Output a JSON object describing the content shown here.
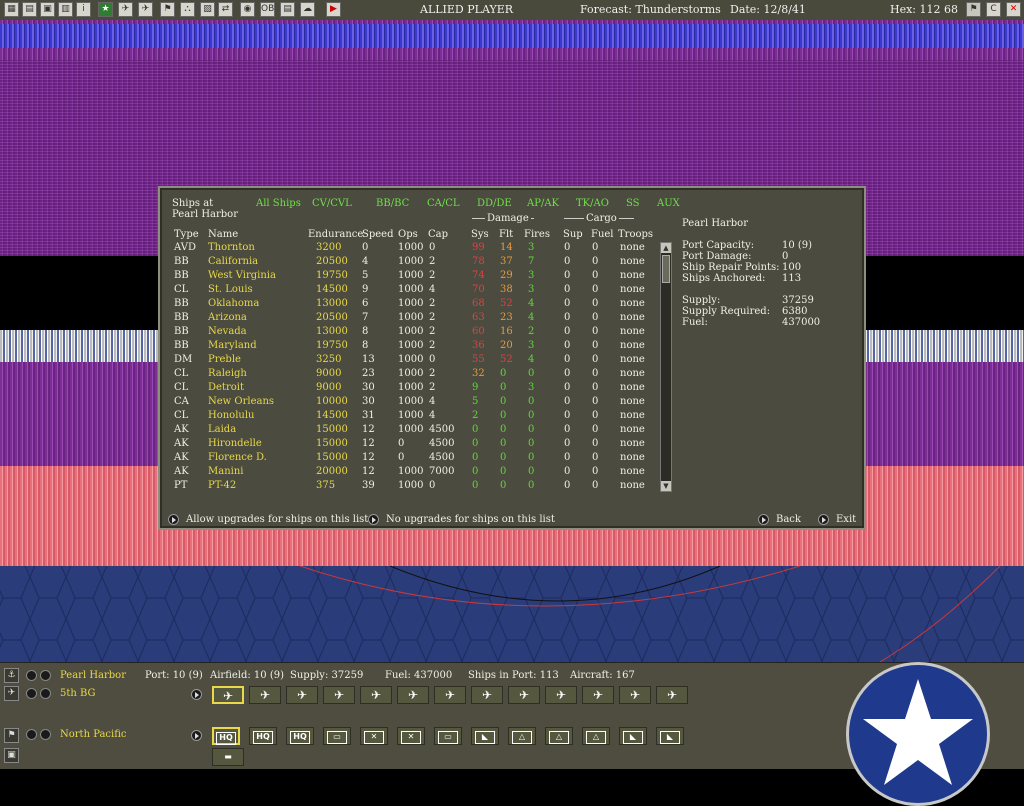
{
  "topbar": {
    "player": "ALLIED PLAYER",
    "forecast": "Forecast: Thunderstorms",
    "date": "Date: 12/8/41",
    "hex": "Hex: 112 68",
    "icons": [
      "menu-icon",
      "list-icon",
      "ship-list-icon",
      "report-icon",
      "info-icon",
      "star-icon",
      "air-icon",
      "aircraft-icon",
      "flag-icon",
      "ground-icon",
      "map-icon",
      "filter-icon",
      "globe-icon",
      "ob-icon",
      "doc-icon",
      "cloud-icon",
      "end-turn-icon"
    ],
    "right_icons": [
      "flag-icon",
      "c-icon",
      "close-icon"
    ]
  },
  "dialog": {
    "title_line1": "Ships at",
    "title_line2": "Pearl Harbor",
    "tabs": [
      "All Ships",
      "CV/CVL",
      "BB/BC",
      "CA/CL",
      "DD/DE",
      "AP/AK",
      "TK/AO",
      "SS",
      "AUX"
    ],
    "group_damage": "Damage",
    "group_cargo": "Cargo",
    "columns": [
      "Type",
      "Name",
      "Endurance",
      "Speed",
      "Ops",
      "Cap",
      "Sys",
      "Flt",
      "Fires",
      "Sup",
      "Fuel",
      "Troops"
    ],
    "rows": [
      {
        "type": "AVD",
        "name": "Thornton",
        "endurance": "3200",
        "speed": "0",
        "ops": "1000",
        "cap": "0",
        "sys": "99",
        "flt": "14",
        "fires": "3",
        "sup": "0",
        "fuel": "0",
        "troops": "none"
      },
      {
        "type": "BB",
        "name": "California",
        "endurance": "20500",
        "speed": "4",
        "ops": "1000",
        "cap": "2",
        "sys": "78",
        "flt": "37",
        "fires": "7",
        "sup": "0",
        "fuel": "0",
        "troops": "none"
      },
      {
        "type": "BB",
        "name": "West Virginia",
        "endurance": "19750",
        "speed": "5",
        "ops": "1000",
        "cap": "2",
        "sys": "74",
        "flt": "29",
        "fires": "3",
        "sup": "0",
        "fuel": "0",
        "troops": "none"
      },
      {
        "type": "CL",
        "name": "St. Louis",
        "endurance": "14500",
        "speed": "9",
        "ops": "1000",
        "cap": "4",
        "sys": "70",
        "flt": "38",
        "fires": "3",
        "sup": "0",
        "fuel": "0",
        "troops": "none"
      },
      {
        "type": "BB",
        "name": "Oklahoma",
        "endurance": "13000",
        "speed": "6",
        "ops": "1000",
        "cap": "2",
        "sys": "68",
        "flt": "52",
        "fires": "4",
        "sup": "0",
        "fuel": "0",
        "troops": "none"
      },
      {
        "type": "BB",
        "name": "Arizona",
        "endurance": "20500",
        "speed": "7",
        "ops": "1000",
        "cap": "2",
        "sys": "63",
        "flt": "23",
        "fires": "4",
        "sup": "0",
        "fuel": "0",
        "troops": "none"
      },
      {
        "type": "BB",
        "name": "Nevada",
        "endurance": "13000",
        "speed": "8",
        "ops": "1000",
        "cap": "2",
        "sys": "60",
        "flt": "16",
        "fires": "2",
        "sup": "0",
        "fuel": "0",
        "troops": "none"
      },
      {
        "type": "BB",
        "name": "Maryland",
        "endurance": "19750",
        "speed": "8",
        "ops": "1000",
        "cap": "2",
        "sys": "36",
        "flt": "20",
        "fires": "3",
        "sup": "0",
        "fuel": "0",
        "troops": "none"
      },
      {
        "type": "DM",
        "name": "Preble",
        "endurance": "3250",
        "speed": "13",
        "ops": "1000",
        "cap": "0",
        "sys": "55",
        "flt": "52",
        "fires": "4",
        "sup": "0",
        "fuel": "0",
        "troops": "none"
      },
      {
        "type": "CL",
        "name": "Raleigh",
        "endurance": "9000",
        "speed": "23",
        "ops": "1000",
        "cap": "2",
        "sys": "32",
        "flt": "0",
        "fires": "0",
        "sup": "0",
        "fuel": "0",
        "troops": "none"
      },
      {
        "type": "CL",
        "name": "Detroit",
        "endurance": "9000",
        "speed": "30",
        "ops": "1000",
        "cap": "2",
        "sys": "9",
        "flt": "0",
        "fires": "3",
        "sup": "0",
        "fuel": "0",
        "troops": "none"
      },
      {
        "type": "CA",
        "name": "New Orleans",
        "endurance": "10000",
        "speed": "30",
        "ops": "1000",
        "cap": "4",
        "sys": "5",
        "flt": "0",
        "fires": "0",
        "sup": "0",
        "fuel": "0",
        "troops": "none"
      },
      {
        "type": "CL",
        "name": "Honolulu",
        "endurance": "14500",
        "speed": "31",
        "ops": "1000",
        "cap": "4",
        "sys": "2",
        "flt": "0",
        "fires": "0",
        "sup": "0",
        "fuel": "0",
        "troops": "none"
      },
      {
        "type": "AK",
        "name": "Laida",
        "endurance": "15000",
        "speed": "12",
        "ops": "1000",
        "cap": "4500",
        "sys": "0",
        "flt": "0",
        "fires": "0",
        "sup": "0",
        "fuel": "0",
        "troops": "none"
      },
      {
        "type": "AK",
        "name": "Hirondelle",
        "endurance": "15000",
        "speed": "12",
        "ops": "0",
        "cap": "4500",
        "sys": "0",
        "flt": "0",
        "fires": "0",
        "sup": "0",
        "fuel": "0",
        "troops": "none"
      },
      {
        "type": "AK",
        "name": "Florence D.",
        "endurance": "15000",
        "speed": "12",
        "ops": "0",
        "cap": "4500",
        "sys": "0",
        "flt": "0",
        "fires": "0",
        "sup": "0",
        "fuel": "0",
        "troops": "none"
      },
      {
        "type": "AK",
        "name": "Manini",
        "endurance": "20000",
        "speed": "12",
        "ops": "1000",
        "cap": "7000",
        "sys": "0",
        "flt": "0",
        "fires": "0",
        "sup": "0",
        "fuel": "0",
        "troops": "none"
      },
      {
        "type": "PT",
        "name": "PT-42",
        "endurance": "375",
        "speed": "39",
        "ops": "1000",
        "cap": "0",
        "sys": "0",
        "flt": "0",
        "fires": "0",
        "sup": "0",
        "fuel": "0",
        "troops": "none"
      }
    ],
    "sys_colors": [
      "#e04040",
      "#e04040",
      "#e04040",
      "#e04040",
      "#e04040",
      "#e04040",
      "#e04040",
      "#e04040",
      "#e04040",
      "#e89a3c",
      "#5fd83c",
      "#5fd83c",
      "#5fd83c",
      "#5fd83c",
      "#5fd83c",
      "#5fd83c",
      "#5fd83c",
      "#5fd83c"
    ],
    "flt_colors": [
      "#e89a3c",
      "#e89a3c",
      "#e89a3c",
      "#e89a3c",
      "#e04040",
      "#e89a3c",
      "#e89a3c",
      "#e89a3c",
      "#e04040",
      "#5fd83c",
      "#5fd83c",
      "#5fd83c",
      "#5fd83c",
      "#5fd83c",
      "#5fd83c",
      "#5fd83c",
      "#5fd83c",
      "#5fd83c"
    ],
    "info": {
      "base": "Pearl Harbor",
      "port_capacity_label": "Port Capacity:",
      "port_capacity": "10 (9)",
      "port_damage_label": "Port Damage:",
      "port_damage": "0",
      "ship_repair_label": "Ship Repair Points:",
      "ship_repair": "100",
      "ships_anchored_label": "Ships Anchored:",
      "ships_anchored": "113",
      "supply_label": "Supply:",
      "supply": "37259",
      "supply_required_label": "Supply Required:",
      "supply_required": "6380",
      "fuel_label": "Fuel:",
      "fuel": "437000"
    },
    "footer": {
      "allow_upgrades": "Allow upgrades for ships on this list",
      "no_upgrades": "No upgrades for ships on this list",
      "back": "Back",
      "exit": "Exit"
    }
  },
  "bottombar": {
    "base_name": "Pearl Harbor",
    "port": "Port: 10 (9)",
    "airfield": "Airfield: 10 (9)",
    "supply": "Supply: 37259",
    "fuel": "Fuel: 437000",
    "ships_in_port": "Ships in Port: 113",
    "aircraft": "Aircraft: 167",
    "air_group": "5th BG",
    "hq": "North Pacific",
    "unit_labels": [
      "HQ",
      "HQ",
      "HQ",
      "",
      "",
      "",
      "",
      "",
      "",
      "",
      "",
      "",
      ""
    ]
  },
  "colors": {
    "accent_green": "#5fd83c",
    "accent_yellow": "#e8d84a",
    "damage_red": "#e04040",
    "damage_orange": "#e89a3c",
    "panel": "#4b4b3f"
  }
}
